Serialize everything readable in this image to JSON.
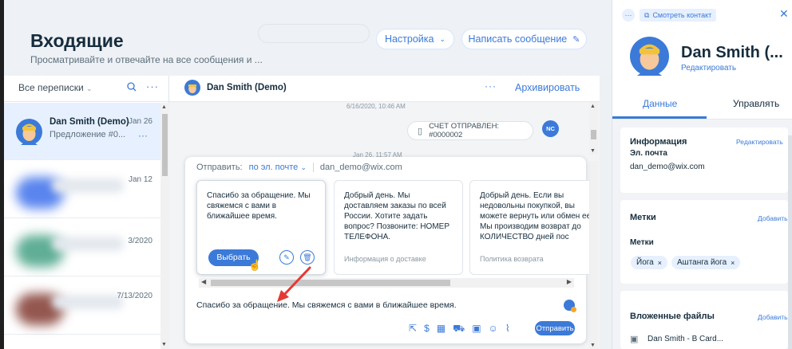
{
  "header": {
    "title": "Входящие",
    "subtitle": "Просматривайте и отвечайте на все сообщения и ...",
    "settings_label": "Настройка",
    "compose_label": "Написать сообщение"
  },
  "conversations": {
    "filter_label": "Все переписки",
    "items": [
      {
        "name": "Dan Smith (Demo)",
        "preview": "Предложение #0...",
        "date": "Jan 26"
      },
      {
        "name": "",
        "preview": "",
        "date": "Jan 12"
      },
      {
        "name": "",
        "preview": "",
        "date": "3/2020"
      },
      {
        "name": "",
        "preview": "",
        "date": "7/13/2020"
      }
    ]
  },
  "chat": {
    "contact_name": "Dan Smith (Demo)",
    "archive_label": "Архивировать",
    "timestamp_1": "6/16/2020, 10:46 AM",
    "timestamp_2": "Jan 26, 11:57 AM",
    "system_message": "СЧЕТ ОТПРАВЛЕН: #0000002",
    "sender_initials": "NC"
  },
  "composer": {
    "send_label": "Отправить:",
    "channel": "по эл. почте",
    "email": "dan_demo@wix.com",
    "quick_replies": [
      {
        "text": "Спасибо за обращение. Мы свяжемся с вами в ближайшее время.",
        "footer": ""
      },
      {
        "text": "Добрый день. Мы доставляем заказы по всей России. Хотите задать вопрос? Позвоните: НОМЕР ТЕЛЕФОНА.",
        "footer": "Информация о доставке"
      },
      {
        "text": "Добрый день. Если вы недовольны покупкой, вы можете вернуть или обмен ее. Мы производим возврат до КОЛИЧЕСТВО дней пос",
        "footer": "Политика возврата"
      }
    ],
    "pick_label": "Выбрать",
    "message": "Спасибо за обращение. Мы свяжемся с вами в ближайшее время.",
    "send_button": "Отправить"
  },
  "contact_panel": {
    "view_contact": "Смотреть контакт",
    "name": "Dan Smith (...",
    "edit": "Редактировать",
    "tab_data": "Данные",
    "tab_manage": "Управлять",
    "info_title": "Информация",
    "info_edit": "Редактировать",
    "email_label": "Эл. почта",
    "email_value": "dan_demo@wix.com",
    "tags_title": "Метки",
    "tags_add": "Добавить",
    "tags_label": "Метки",
    "tags": [
      "Йога",
      "Аштанга йога"
    ],
    "files_title": "Вложенные файлы",
    "files_add": "Добавить",
    "file_name": "Dan Smith - B Card..."
  },
  "colors": {
    "accent": "#3b7ad8",
    "active_row": "#e7f0fe",
    "arrow": "#e53935"
  }
}
